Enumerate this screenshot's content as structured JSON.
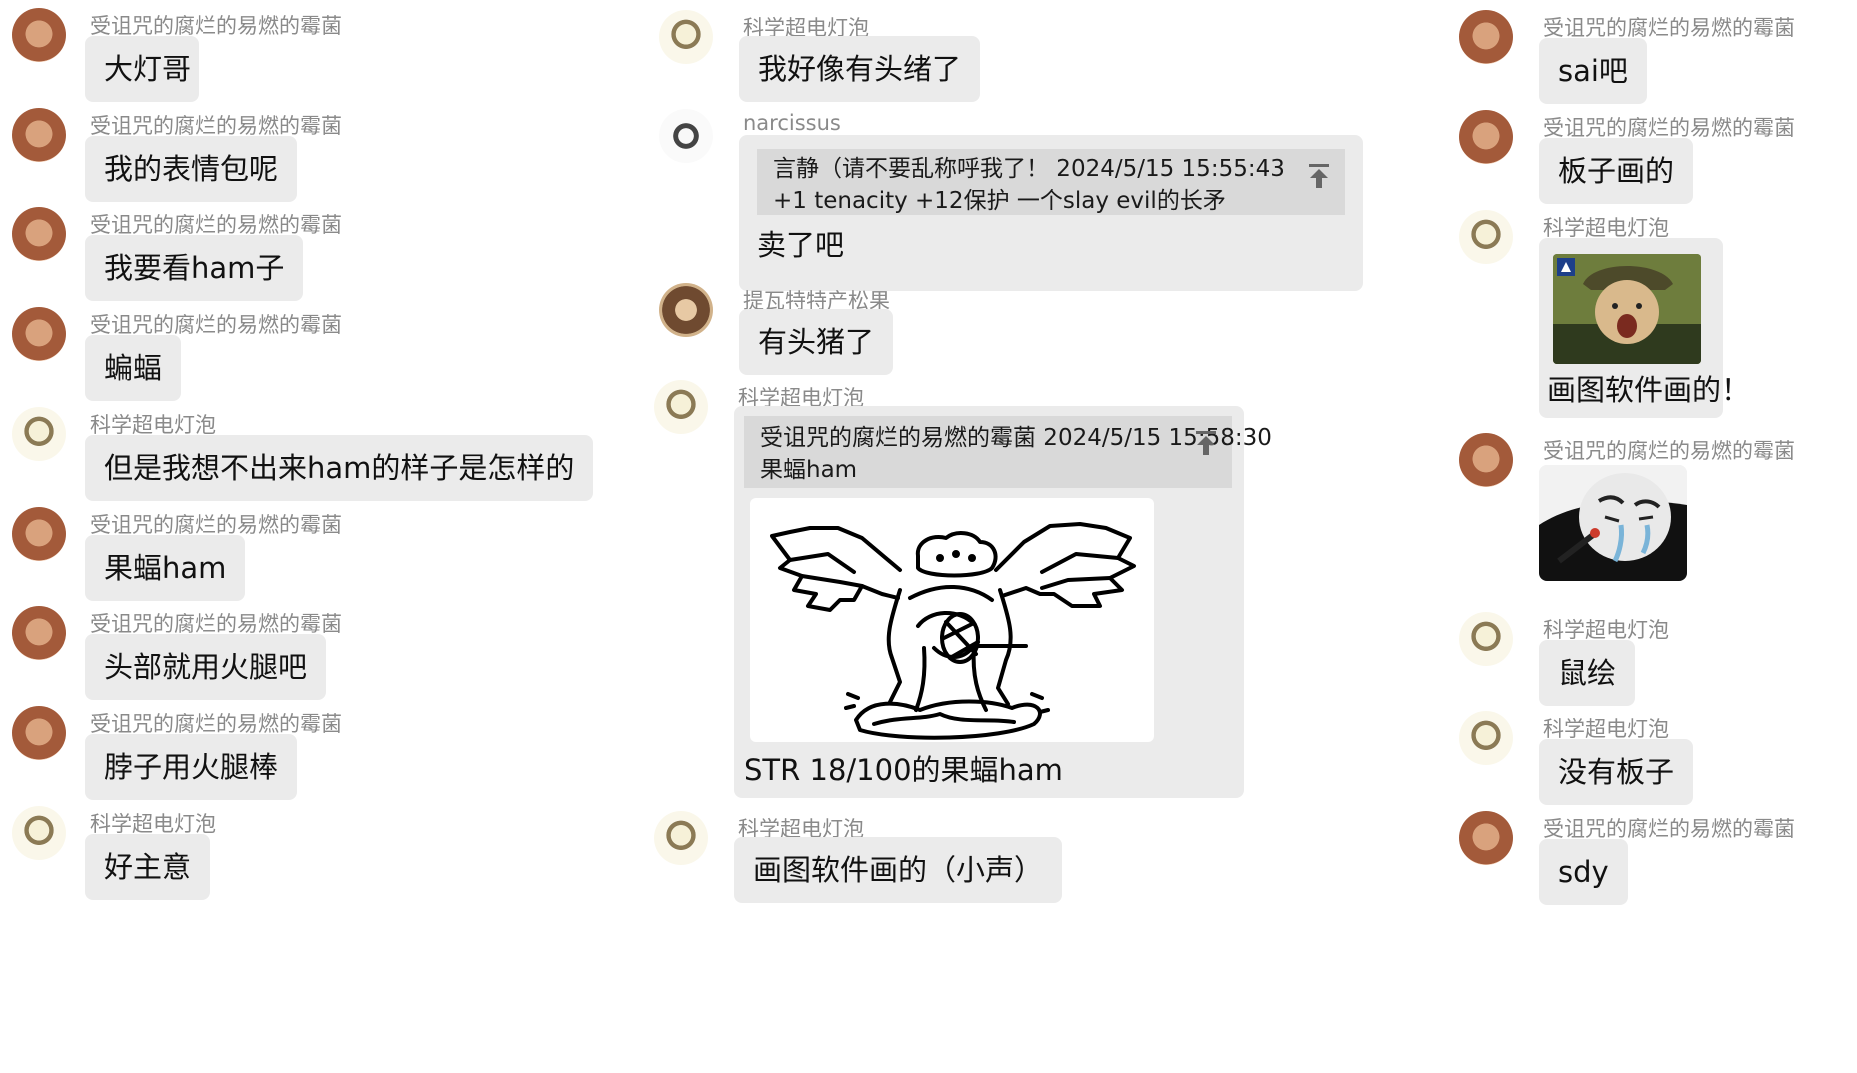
{
  "users": {
    "mold": "受诅咒的腐烂的易燃的霉菌",
    "bulb": "科学超电灯泡",
    "narc": "narcissus",
    "tiwa": "提瓦特特产松果"
  },
  "left": [
    {
      "user": "受诅咒的腐烂的易燃的霉菌",
      "text": "大灯哥"
    },
    {
      "user": "受诅咒的腐烂的易燃的霉菌",
      "text": "我的表情包呢"
    },
    {
      "user": "受诅咒的腐烂的易燃的霉菌",
      "text": "我要看ham子"
    },
    {
      "user": "受诅咒的腐烂的易燃的霉菌",
      "text": "蝙蝠"
    },
    {
      "user": "科学超电灯泡",
      "text": "但是我想不出来ham的样子是怎样的"
    },
    {
      "user": "受诅咒的腐烂的易燃的霉菌",
      "text": "果蝠ham"
    },
    {
      "user": "受诅咒的腐烂的易燃的霉菌",
      "text": "头部就用火腿吧"
    },
    {
      "user": "受诅咒的腐烂的易燃的霉菌",
      "text": "脖子用火腿棒"
    },
    {
      "user": "科学超电灯泡",
      "text": "好主意"
    }
  ],
  "mid": {
    "m1": {
      "user": "科学超电灯泡",
      "text": "我好像有头绪了"
    },
    "m2": {
      "user": "narcissus",
      "quote_header": "言静（请不要乱称呼我了！  2024/5/15 15:55:43",
      "quote_body": "+1 tenacity +12保护 一个slay evil的长矛",
      "text": "卖了吧"
    },
    "m3": {
      "user": "提瓦特特产松果",
      "text": "有头猪了"
    },
    "m4": {
      "user": "科学超电灯泡",
      "quote_header": "受诅咒的腐烂的易燃的霉菌  2024/5/15 15:58:30",
      "quote_body": "果蝠ham",
      "image_name": "bat-ham-drawing",
      "text": "STR 18/100的果蝠ham"
    },
    "m5": {
      "user": "科学超电灯泡",
      "text": "画图软件画的（小声）"
    }
  },
  "right": {
    "r1": {
      "user": "受诅咒的腐烂的易燃的霉菌",
      "text": "sai吧"
    },
    "r2": {
      "user": "受诅咒的腐烂的易燃的霉菌",
      "text": "板子画的"
    },
    "r3": {
      "user": "科学超电灯泡",
      "text": "画图软件画的！"
    },
    "r4": {
      "user": "受诅咒的腐烂的易燃的霉菌",
      "sticker": "crying-face-sticker"
    },
    "r5": {
      "user": "科学超电灯泡",
      "text": "鼠绘"
    },
    "r6": {
      "user": "科学超电灯泡",
      "text": "没有板子"
    },
    "r7": {
      "user": "受诅咒的腐烂的易燃的霉菌",
      "text": "sdy"
    }
  },
  "colors": {
    "bubble": "#ebebeb",
    "quote": "#d9d9d9",
    "name": "#8a8a8a"
  }
}
